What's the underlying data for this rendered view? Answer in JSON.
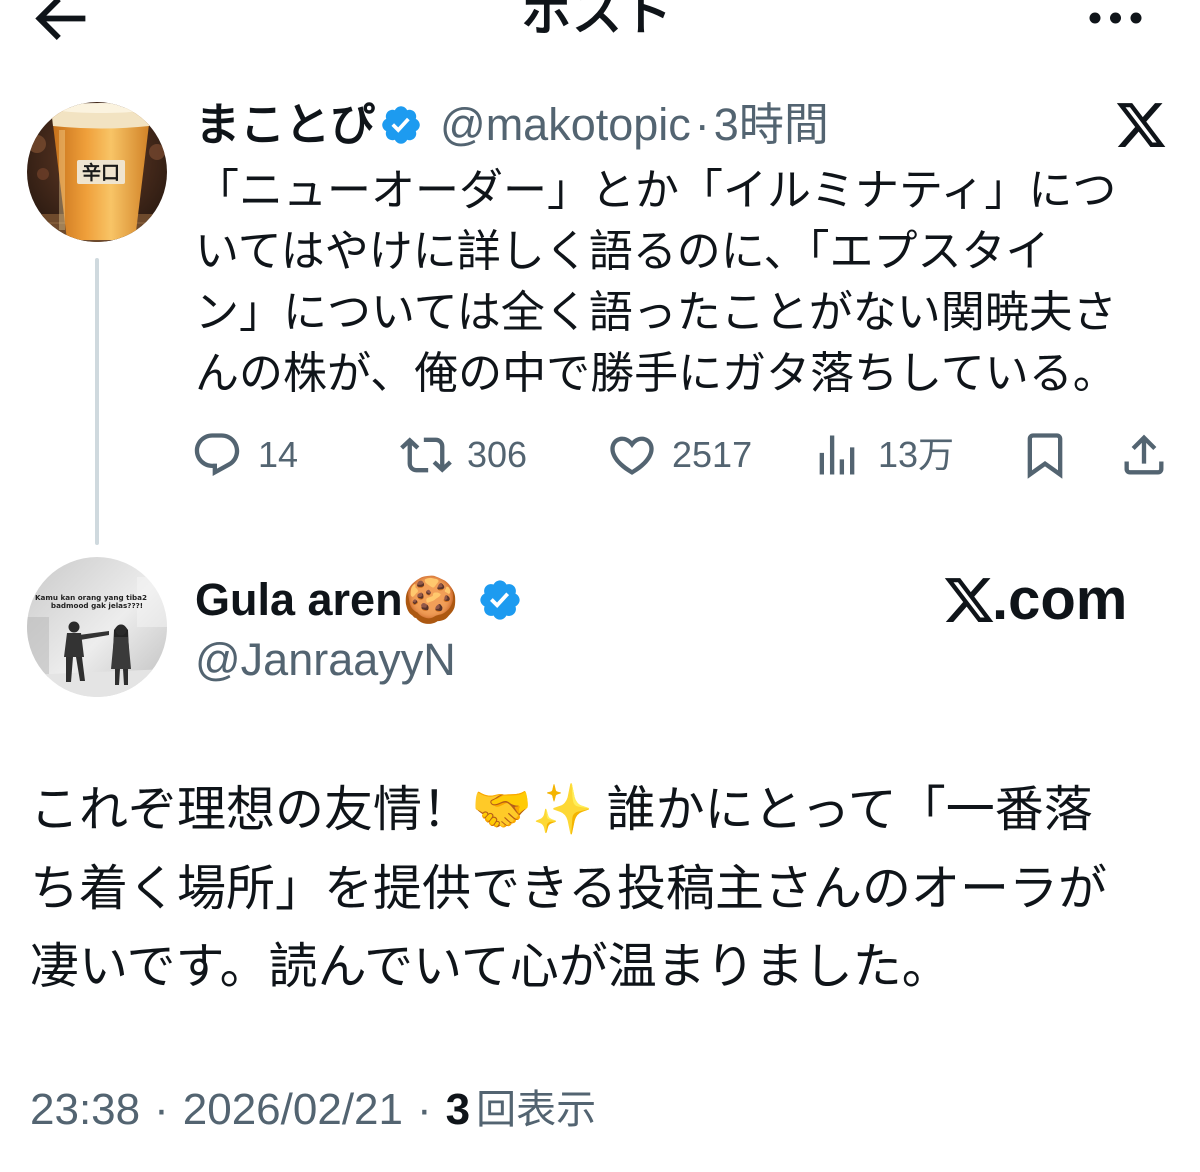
{
  "header": {
    "title": "ポスト",
    "back_icon": "arrow-left-icon",
    "more_icon": "more-horizontal-icon"
  },
  "parent_post": {
    "author": {
      "name": "まことぴ",
      "handle": "@makotopic",
      "verified": true,
      "avatar_label": "辛口"
    },
    "separator": "·",
    "time_ago": "3時間",
    "body_lines": [
      "「ニューオーダー」とか「イルミナティ」につ",
      "いてはやけに詳しく語るのに、「エプスタイ",
      "ン」については全く語ったことがない関暁夫さ",
      "んの株が、俺の中で勝手にガタ落ちしている。"
    ],
    "metrics": {
      "replies": "14",
      "reposts": "306",
      "likes": "2517",
      "views": "13万"
    },
    "icons": {
      "reply": "reply-icon",
      "repost": "repost-icon",
      "like": "heart-icon",
      "views": "views-chart-icon",
      "bookmark": "bookmark-icon",
      "share": "share-icon",
      "watermark": "x-logo-icon"
    }
  },
  "reply_post": {
    "author": {
      "name": "Gula aren🍪",
      "handle": "@JanraayyN",
      "verified": true,
      "avatar_caption_lines": [
        "Kamu kan orang yang tiba2",
        "badmood gak jelas???!"
      ]
    },
    "brand": {
      "logo_icon": "x-logo-icon",
      "suffix": ".com"
    },
    "body_lines": [
      "これぞ理想の友情！🤝✨ 誰かにとって「一番落",
      "ち着く場所」を提供できる投稿主さんのオーラが",
      "凄いです。読んでいて心が温まりました。"
    ],
    "meta": {
      "time": "23:38",
      "separator": "·",
      "date": "2026/02/21",
      "views_count": "3",
      "views_label": "回表示"
    }
  },
  "colors": {
    "text_primary": "#0f1419",
    "text_secondary": "#536471",
    "verified_blue": "#1d9bf0",
    "thread_line": "#cfd9de",
    "background": "#ffffff"
  }
}
